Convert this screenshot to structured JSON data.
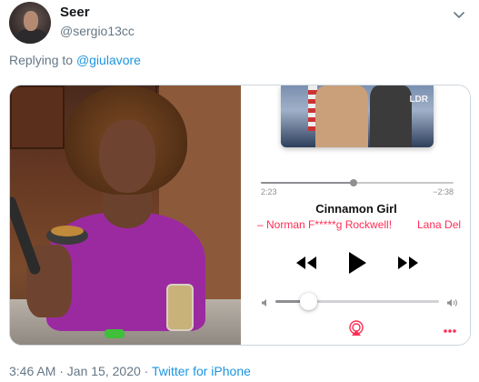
{
  "tweet": {
    "display_name": "Seer",
    "handle": "@sergio13cc",
    "replying_prefix": "Replying to",
    "replying_to": "@giulavore",
    "timestamp": "3:46 AM · Jan 15, 2020 · ",
    "source": "Twitter for iPhone"
  },
  "player": {
    "elapsed": "2:23",
    "remaining": "−2:38",
    "progress": 0.48,
    "song_title": "Cinnamon Girl",
    "album": "– Norman F*****g Rockwell!",
    "artist": "Lana Del",
    "volume": 0.2,
    "accent_color": "#ff2d55",
    "icons": [
      "rewind-icon",
      "play-icon",
      "fast-forward-icon",
      "volume-low-icon",
      "volume-high-icon",
      "airplay-icon",
      "more-icon"
    ]
  },
  "colors": {
    "link": "#1b95e0",
    "muted": "#657786",
    "text": "#14171a"
  }
}
